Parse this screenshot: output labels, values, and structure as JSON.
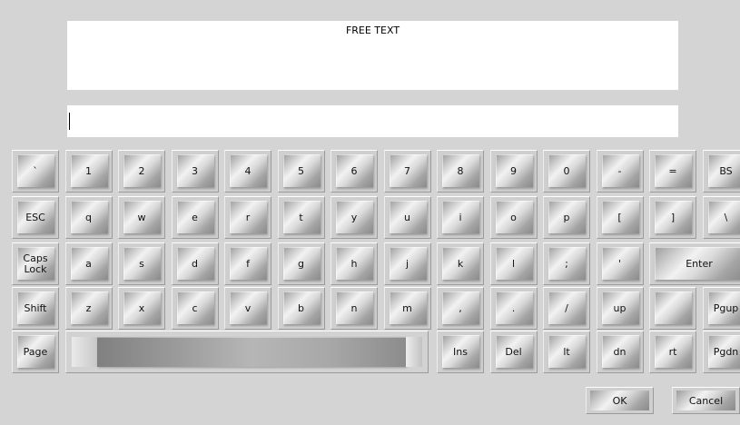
{
  "header": {
    "title": "FREE TEXT"
  },
  "input": {
    "value": ""
  },
  "keyboard": {
    "row1": [
      "`",
      "1",
      "2",
      "3",
      "4",
      "5",
      "6",
      "7",
      "8",
      "9",
      "0",
      "-",
      "=",
      "BS"
    ],
    "row2": [
      "ESC",
      "q",
      "w",
      "e",
      "r",
      "t",
      "y",
      "u",
      "i",
      "o",
      "p",
      "[",
      "]",
      "\\"
    ],
    "row3": [
      "Caps\nLock",
      "a",
      "s",
      "d",
      "f",
      "g",
      "h",
      "j",
      "k",
      "l",
      ";",
      "'",
      "Enter"
    ],
    "row4": [
      "Shift",
      "z",
      "x",
      "c",
      "v",
      "b",
      "n",
      "m",
      ",",
      ".",
      "/",
      "up",
      "",
      "Pgup"
    ],
    "row5": [
      "Page",
      "Ins",
      "Del",
      "lt",
      "dn",
      "rt",
      "Pgdn"
    ]
  },
  "actions": {
    "ok": "OK",
    "cancel": "Cancel"
  }
}
